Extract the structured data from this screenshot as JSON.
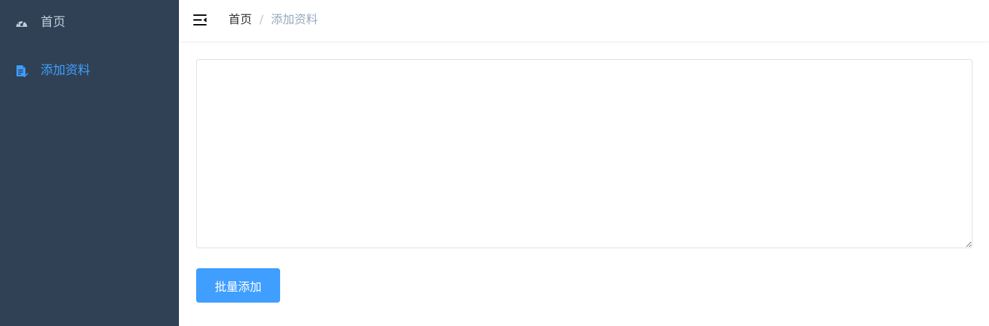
{
  "sidebar": {
    "background": "#304156",
    "items": [
      {
        "label": "首页",
        "icon": "dashboard-icon",
        "active": false,
        "color": "#bfcbd9"
      },
      {
        "label": "添加资料",
        "icon": "document-edit-icon",
        "active": true,
        "color": "#409eff"
      }
    ]
  },
  "navbar": {
    "toggle_icon": "hamburger-icon",
    "breadcrumb": {
      "home": "首页",
      "separator": "/",
      "current": "添加资料"
    }
  },
  "main": {
    "textarea": {
      "value": "",
      "placeholder": ""
    },
    "submit_label": "批量添加",
    "accent": "#409eff"
  }
}
